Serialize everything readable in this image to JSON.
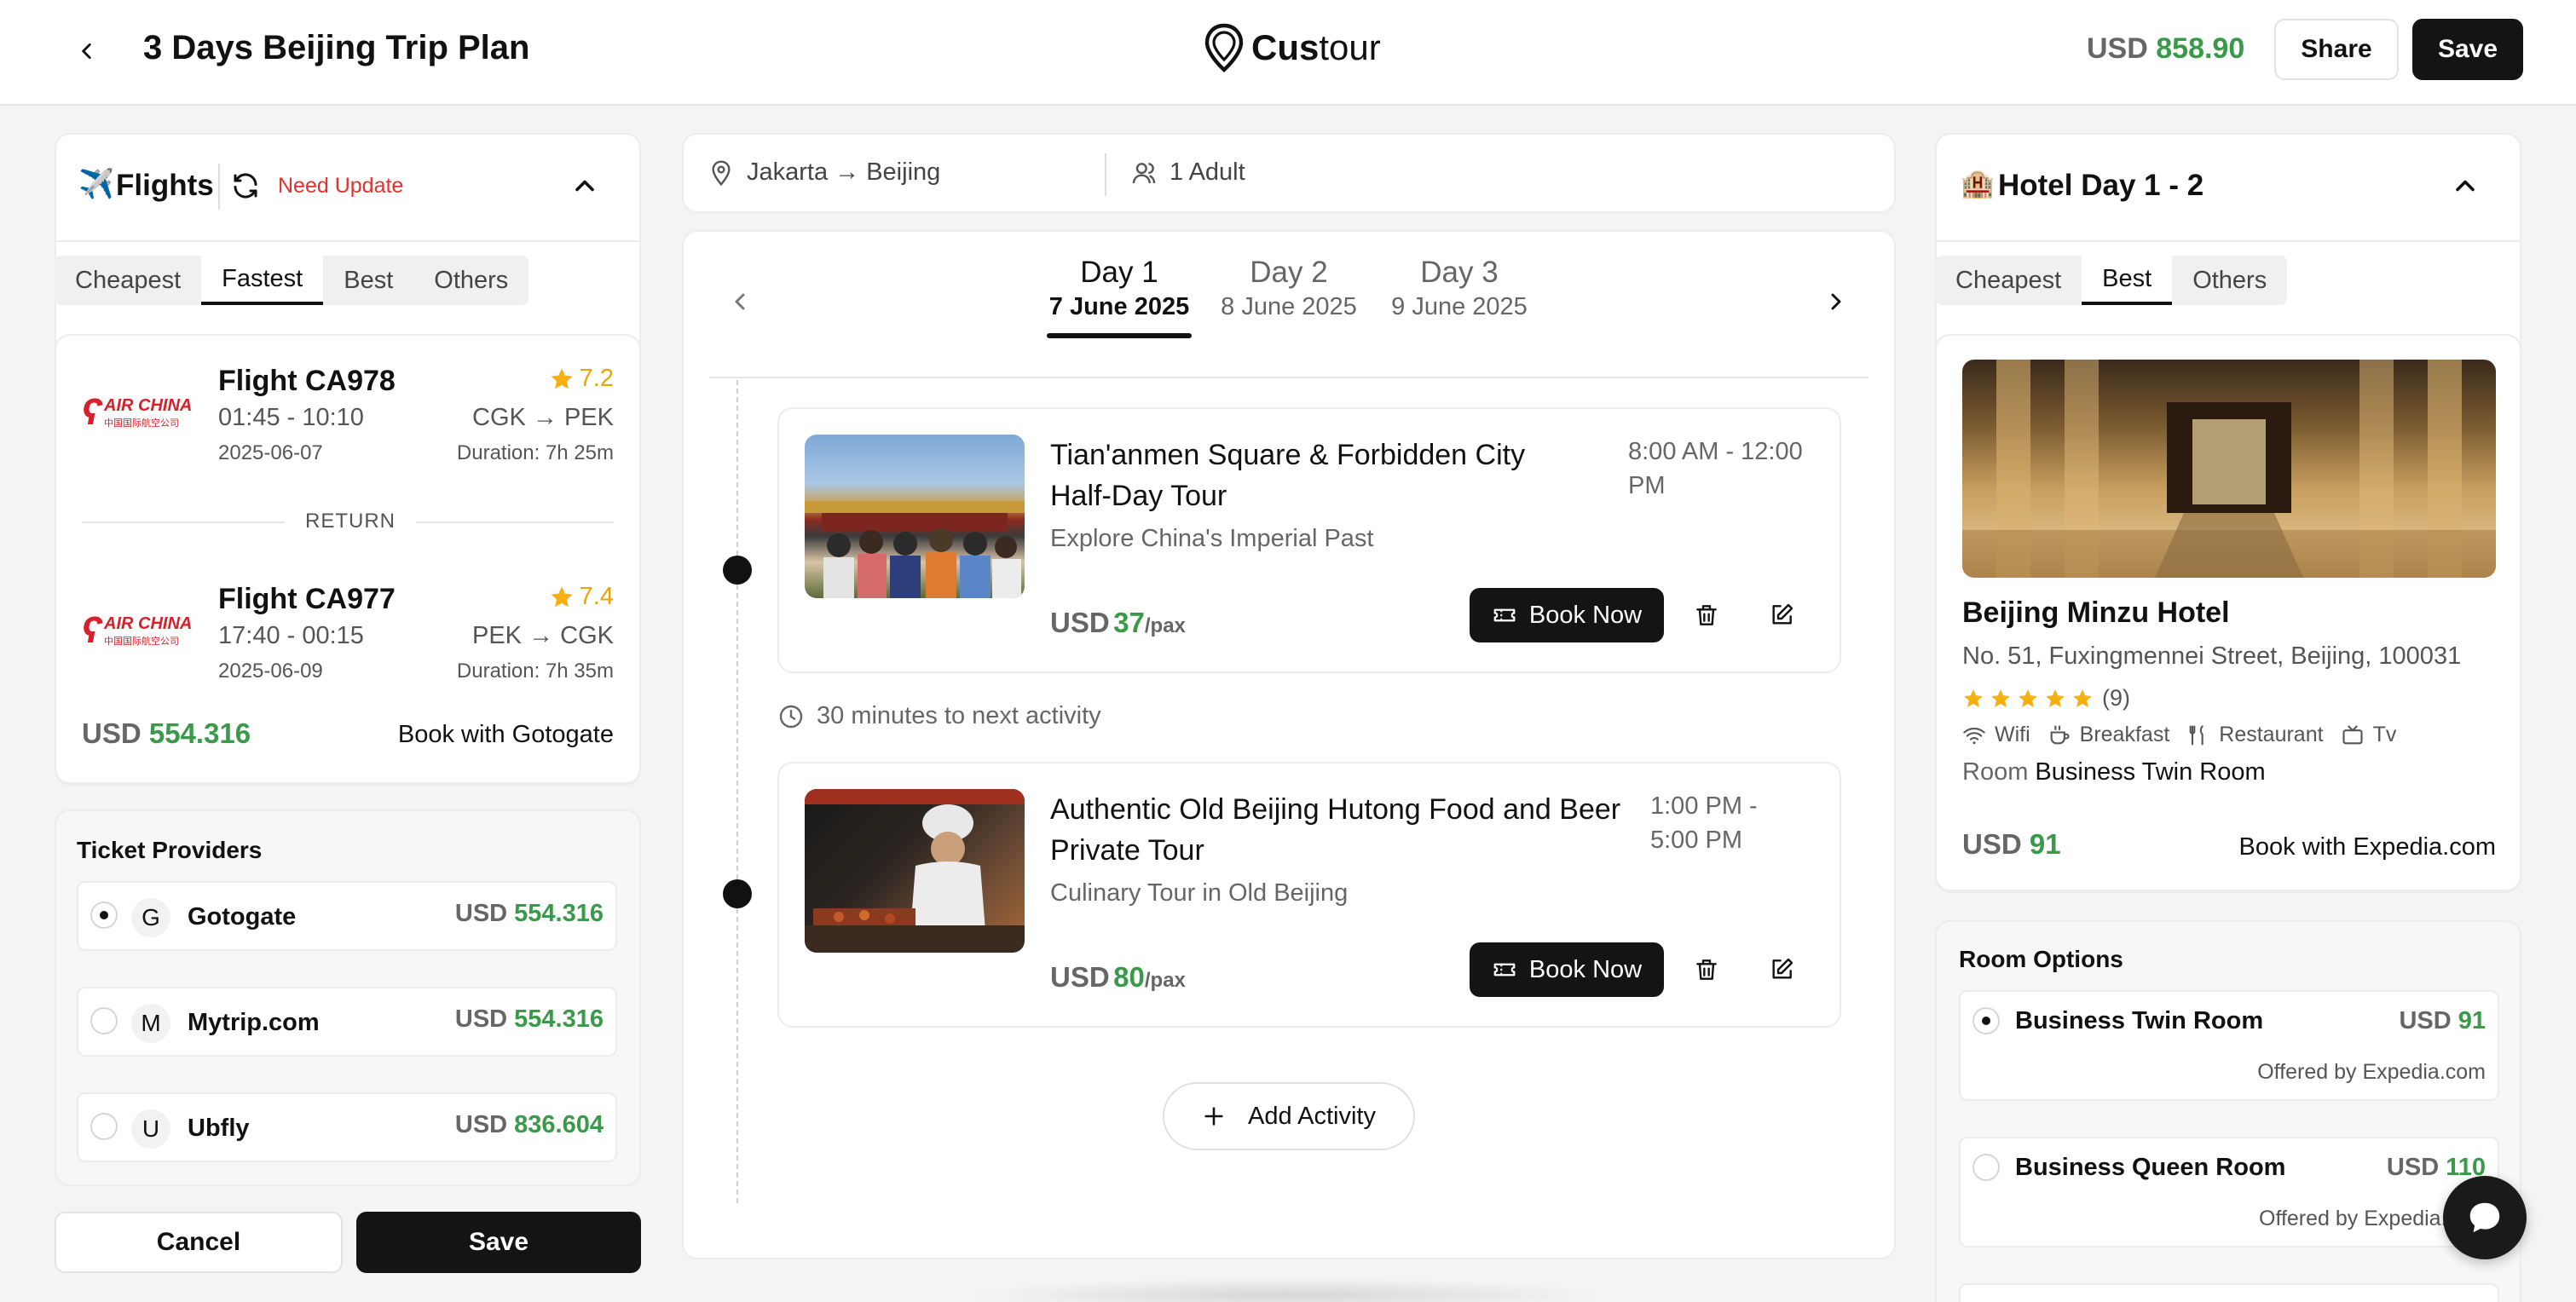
{
  "header": {
    "title": "3 Days Beijing Trip Plan",
    "logo_bold": "Cus",
    "logo_light": "tour",
    "total_prefix": "USD",
    "total_value": "858.90",
    "share_label": "Share",
    "save_label": "Save"
  },
  "flights": {
    "title": "Flights",
    "status": "Need Update",
    "tabs": [
      "Cheapest",
      "Fastest",
      "Best",
      "Others"
    ],
    "active_tab": "Fastest",
    "outbound": {
      "name": "Flight CA978",
      "time": "01:45 - 10:10",
      "date": "2025-06-07",
      "rating": "7.2",
      "route": "CGK → PEK",
      "duration": "Duration: 7h 25m"
    },
    "return_label": "RETURN",
    "inbound": {
      "name": "Flight CA977",
      "time": "17:40 - 00:15",
      "date": "2025-06-09",
      "rating": "7.4",
      "route": "PEK → CGK",
      "duration": "Duration: 7h 35m"
    },
    "price_prefix": "USD",
    "price_value": "554.316",
    "book_with_prefix": "Book with",
    "book_with_name": "Gotogate",
    "airline_logo_text": "AIR CHINA",
    "airline_logo_sub": "中国国际航空公司"
  },
  "providers": {
    "title": "Ticket Providers",
    "items": [
      {
        "initial": "G",
        "name": "Gotogate",
        "prefix": "USD",
        "value": "554.316",
        "selected": true
      },
      {
        "initial": "M",
        "name": "Mytrip.com",
        "prefix": "USD",
        "value": "554.316",
        "selected": false
      },
      {
        "initial": "U",
        "name": "Ubfly",
        "prefix": "USD",
        "value": "836.604",
        "selected": false
      }
    ]
  },
  "footer": {
    "cancel_label": "Cancel",
    "save_label": "Save"
  },
  "trip": {
    "route": "Jakarta → Beijing",
    "travelers": "1 Adult",
    "days": [
      {
        "label": "Day 1",
        "date": "7 June 2025",
        "active": true
      },
      {
        "label": "Day 2",
        "date": "8 June 2025",
        "active": false
      },
      {
        "label": "Day 3",
        "date": "9 June 2025",
        "active": false
      }
    ],
    "activities": [
      {
        "title_line1": "Tian'anmen Square & Forbidden City",
        "title_line2": "Half-Day Tour",
        "subtitle": "Explore China's Imperial Past",
        "time_line1": "8:00 AM - 12:00",
        "time_line2": "PM",
        "price_prefix": "USD",
        "price_value": "37",
        "price_unit": "/pax",
        "book_label": "Book Now"
      },
      {
        "title_line1": "Authentic Old Beijing Hutong Food and Beer",
        "title_line2": "Private Tour",
        "subtitle": "Culinary Tour in Old Beijing",
        "time_line1": "1:00 PM -",
        "time_line2": "5:00 PM",
        "price_prefix": "USD",
        "price_value": "80",
        "price_unit": "/pax",
        "book_label": "Book Now"
      }
    ],
    "gap_text": "30 minutes to next activity",
    "add_activity_label": "Add Activity"
  },
  "hotel": {
    "title": "Hotel Day 1 - 2",
    "tabs": [
      "Cheapest",
      "Best",
      "Others"
    ],
    "active_tab": "Best",
    "name": "Beijing Minzu Hotel",
    "address": "No. 51, Fuxingmennei Street, Beijing, 100031",
    "stars": 5,
    "reviews": "(9)",
    "amenities": [
      "Wifi",
      "Breakfast",
      "Restaurant",
      "Tv"
    ],
    "room_prefix": "Room",
    "room_name": "Business Twin Room",
    "price_prefix": "USD",
    "price_value": "91",
    "book_with_prefix": "Book with",
    "book_with_name": "Expedia.com"
  },
  "room_options": {
    "title": "Room Options",
    "items": [
      {
        "name": "Business Twin Room",
        "prefix": "USD",
        "value": "91",
        "offered_prefix": "Offered by",
        "offered_name": "Expedia.com",
        "selected": true
      },
      {
        "name": "Business Queen Room",
        "prefix": "USD",
        "value": "110",
        "offered_prefix": "Offered by",
        "offered_name": "Expedia.",
        "selected": false
      }
    ]
  },
  "colors": {
    "accent_green": "#3a9a4a",
    "need_update_red": "#e0322e",
    "star_gold": "#f5b014",
    "dark": "#141414"
  },
  "icons": [
    "back-arrow-icon",
    "location-pin-icon",
    "refresh-icon",
    "chevron-up-icon",
    "star-icon",
    "user-icon",
    "chevron-left-icon",
    "chevron-right-icon",
    "ticket-icon",
    "trash-icon",
    "edit-icon",
    "clock-icon",
    "plus-icon",
    "wifi-icon",
    "coffee-icon",
    "utensils-icon",
    "tv-icon",
    "chat-icon"
  ]
}
